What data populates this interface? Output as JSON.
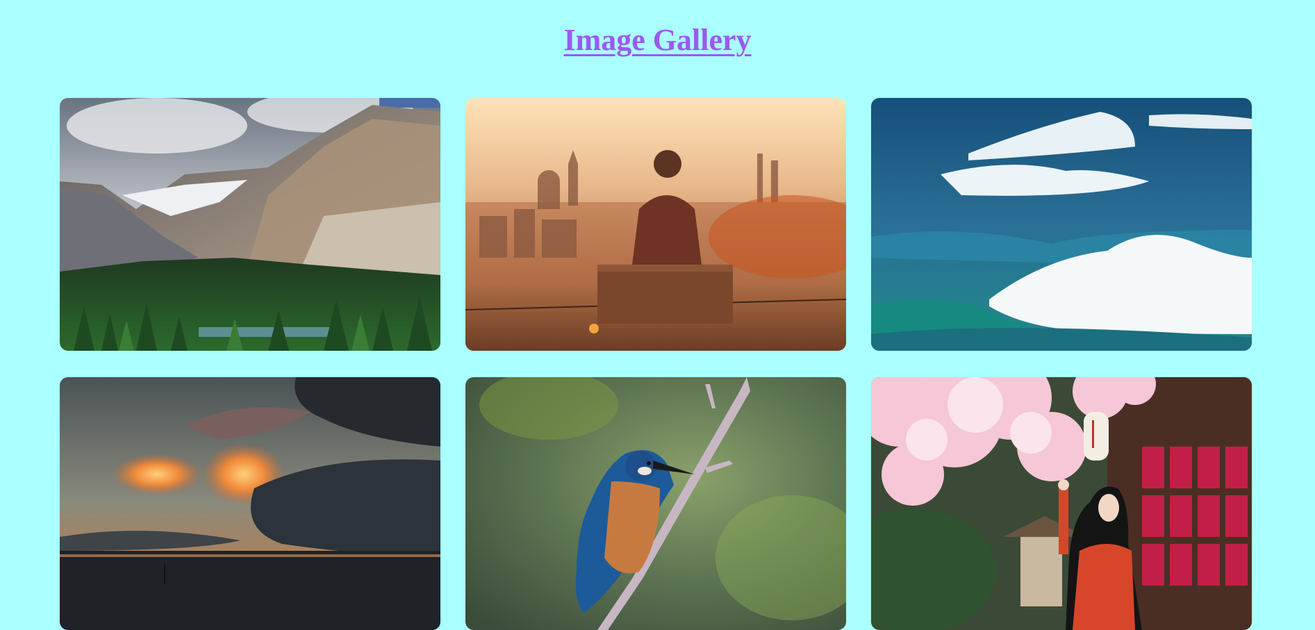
{
  "page": {
    "title": "Image Gallery"
  },
  "gallery": {
    "images": [
      {
        "subject": "mountain-lake-forest"
      },
      {
        "subject": "person-overlooking-city-sunset"
      },
      {
        "subject": "ocean-waves"
      },
      {
        "subject": "stormy-sky-sunset-sea"
      },
      {
        "subject": "kingfisher-on-branch"
      },
      {
        "subject": "woman-cherry-blossoms"
      }
    ]
  },
  "colors": {
    "background": "#aaffff",
    "title": "#9b59f0"
  }
}
